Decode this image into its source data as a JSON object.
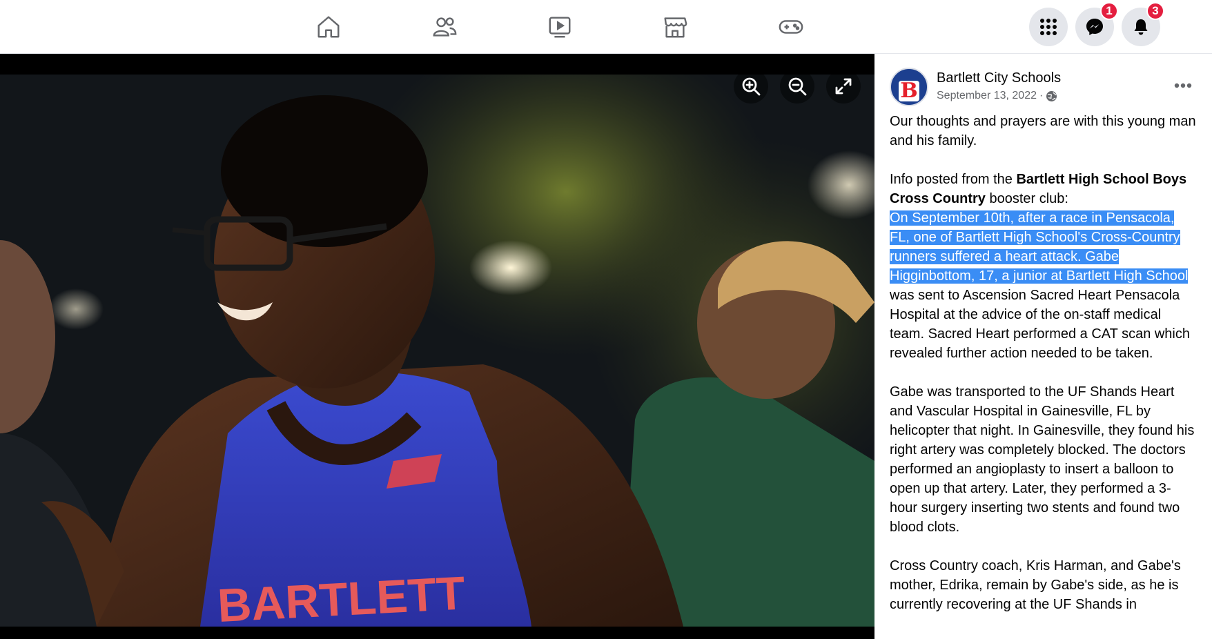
{
  "nav": {
    "icons": [
      "home-icon",
      "friends-icon",
      "watch-icon",
      "marketplace-icon",
      "gaming-icon"
    ]
  },
  "header_right": {
    "menu_icon": "grid-menu-icon",
    "messenger_icon": "messenger-icon",
    "messenger_badge": "1",
    "notifications_icon": "bell-icon",
    "notifications_badge": "3"
  },
  "photo": {
    "controls": [
      "zoom-in-icon",
      "zoom-out-icon",
      "fullscreen-icon"
    ],
    "jersey_text": "BARTLETT"
  },
  "post": {
    "page_name": "Bartlett City Schools",
    "date": "September 13, 2022",
    "date_separator": "·",
    "privacy_icon": "globe-icon",
    "avatar_letter": "B",
    "p1": "Our thoughts and prayers are with this young man and his family.",
    "p2_prefix": "Info posted from the ",
    "p2_bold": "Bartlett High School Boys Cross Country",
    "p2_suffix": " booster club:",
    "p2_highlight": "On September 10th, after a race in Pensacola, FL, one of Bartlett High School's Cross-Country runners suffered a heart attack. Gabe Higginbottom, 17, a junior at Bartlett High School",
    "p2_rest": " was sent to Ascension Sacred Heart Pensacola Hospital at the advice of the on-staff medical team. Sacred Heart performed a CAT scan which revealed further action needed to be taken.",
    "p3": "Gabe was transported to the UF Shands Heart and Vascular Hospital in Gainesville, FL by helicopter that night. In Gainesville, they found his right artery was completely blocked. The doctors performed an angioplasty to insert a balloon to open up that artery. Later, they performed a 3-hour surgery inserting two stents and found two blood clots.",
    "p4": "Cross Country coach, Kris Harman, and Gabe's mother, Edrika, remain by Gabe's side, as he is currently recovering at the UF Shands in"
  },
  "colors": {
    "highlight": "#3a8df5",
    "badge": "#e41e3f",
    "nav_icon": "#65676b"
  }
}
